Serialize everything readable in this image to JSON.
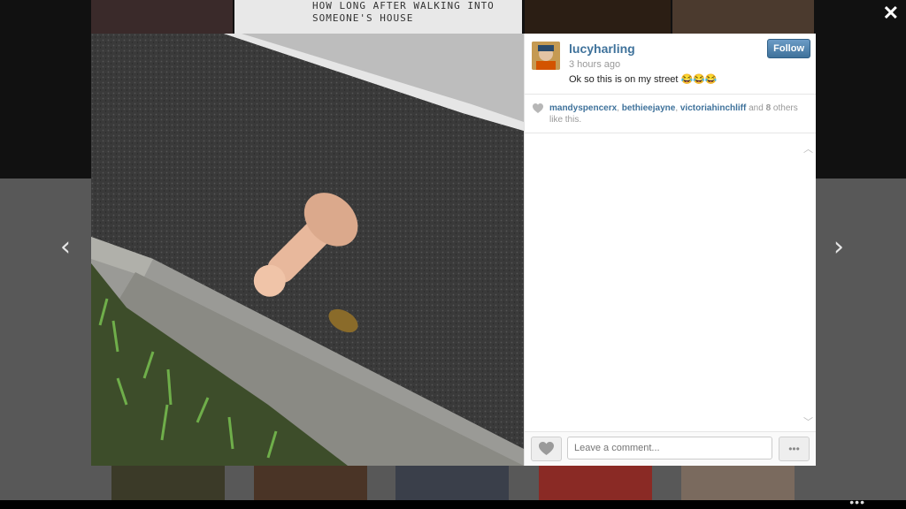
{
  "overlay": {
    "close_symbol": "✕",
    "prev_symbol": "‹",
    "next_symbol": "›",
    "more_symbol": "•••",
    "background_sign_text": "HOW LONG AFTER WALKING INTO SOMEONE'S HOUSE"
  },
  "post": {
    "username": "lucyharling",
    "time": "3 hours ago",
    "caption": "Ok so this is on my street 😂😂😂",
    "follow_label": "Follow",
    "likes": {
      "liker1": "mandyspencerx",
      "sep1": ", ",
      "liker2": "bethieejayne",
      "sep2": ", ",
      "liker3": "victoriahinchliff",
      "and_text": " and ",
      "others_count": "8",
      "others_text": " others like this."
    }
  },
  "comment": {
    "placeholder": "Leave a comment...",
    "more_label": "•••"
  },
  "colors": {
    "link": "#3f729b",
    "follow_button": "#3f729b",
    "overlay_bg": "#585858"
  },
  "icons": [
    "close-icon",
    "chevron-left-icon",
    "chevron-right-icon",
    "heart-icon",
    "more-icon"
  ]
}
